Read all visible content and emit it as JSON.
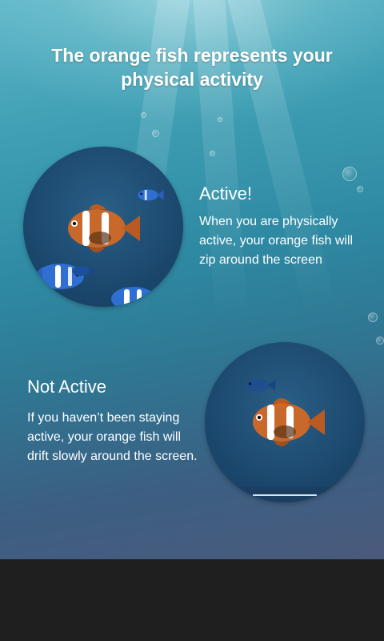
{
  "headline": "The orange fish represents your physical activity",
  "active": {
    "title": "Active!",
    "description": "When you are physically active, your orange fish will zip around the screen"
  },
  "inactive": {
    "title": "Not Active",
    "description": "If you haven’t been staying active, your orange fish will drift slowly around the screen."
  },
  "colors": {
    "ocean_top": "#5fb7c8",
    "ocean_bottom": "#4a5a7c",
    "fish_orange": "#c8692b",
    "fish_blue": "#2f6fd1",
    "bottom_bar": "#1f1f1f"
  },
  "images": {
    "active_circle": "orange-fish-zipping-illustration",
    "inactive_circle": "orange-fish-drifting-illustration"
  }
}
